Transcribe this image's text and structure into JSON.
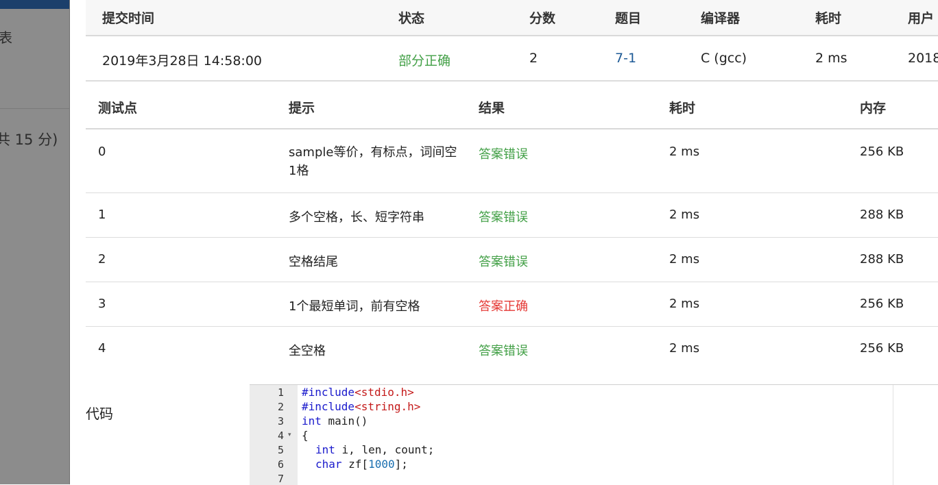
{
  "sidebar": {
    "text1": "表",
    "text2": "共 15 分)"
  },
  "summary": {
    "headers": [
      "提交时间",
      "状态",
      "分数",
      "题目",
      "编译器",
      "耗时",
      "用户"
    ],
    "row": {
      "time": "2019年3月28日 14:58:00",
      "status": "部分正确",
      "score": "2",
      "problem": "7-1",
      "compiler": "C (gcc)",
      "duration": "2 ms",
      "user": "2018"
    }
  },
  "tests": {
    "headers": [
      "测试点",
      "提示",
      "结果",
      "耗时",
      "内存"
    ],
    "rows": [
      {
        "id": "0",
        "hint": "sample等价，有标点，词间空1格",
        "result": "答案错误",
        "time": "2 ms",
        "memory": "256 KB"
      },
      {
        "id": "1",
        "hint": "多个空格，长、短字符串",
        "result": "答案错误",
        "time": "2 ms",
        "memory": "288 KB"
      },
      {
        "id": "2",
        "hint": "空格结尾",
        "result": "答案错误",
        "time": "2 ms",
        "memory": "288 KB"
      },
      {
        "id": "3",
        "hint": "1个最短单词，前有空格",
        "result": "答案正确",
        "time": "2 ms",
        "memory": "256 KB"
      },
      {
        "id": "4",
        "hint": "全空格",
        "result": "答案错误",
        "time": "2 ms",
        "memory": "256 KB"
      }
    ]
  },
  "code": {
    "label": "代码",
    "line_numbers": [
      "1",
      "2",
      "3",
      "4",
      "5",
      "6",
      "7"
    ],
    "lines": {
      "l1_kw": "#include",
      "l1_str": "<stdio.h>",
      "l2_kw": "#include",
      "l2_str": "<string.h>",
      "l3_kw": "int",
      "l3_rest": " main()",
      "l4": "{",
      "l5_kw": "int",
      "l5_rest": " i, len, count;",
      "l6_kw": "char",
      "l6_rest": " zf[",
      "l6_num": "1000",
      "l6_end": "];"
    },
    "fold_marker": "▾"
  },
  "colors": {
    "wrong": "#43a047",
    "correct": "#e53935",
    "partial": "#43a047",
    "link": "#1e5a96"
  }
}
